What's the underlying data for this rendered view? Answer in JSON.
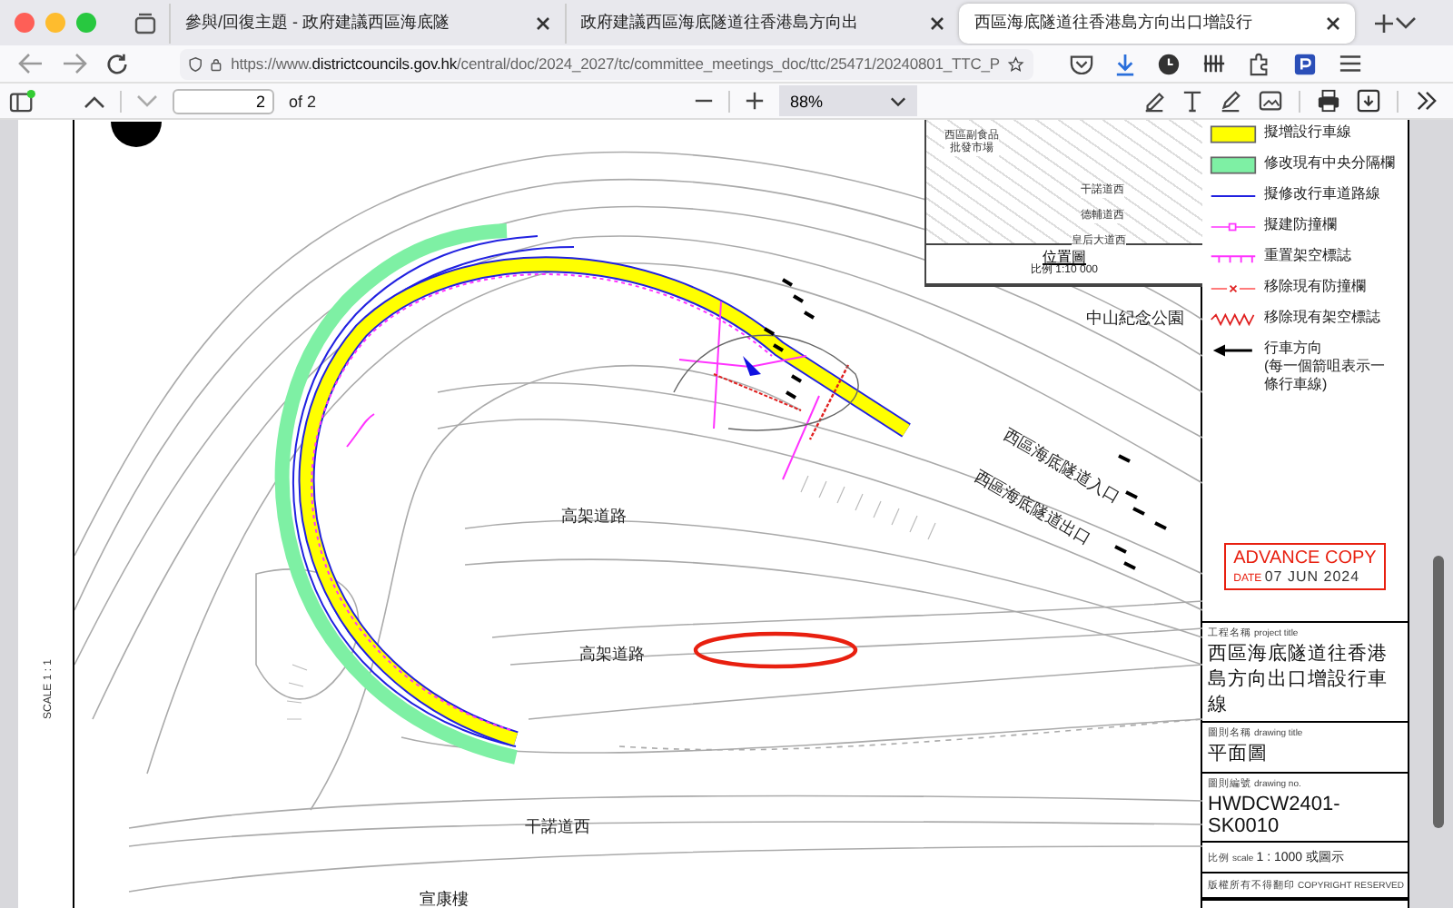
{
  "browser": {
    "tabs": [
      {
        "title": "參與/回復主題 - 政府建議西區海底隧",
        "selected": false
      },
      {
        "title": "政府建議西區海底隧道往香港島方向出",
        "selected": false
      },
      {
        "title": "西區海底隧道往香港島方向出口增設行",
        "selected": true
      }
    ],
    "url": {
      "prefix": "https://www.",
      "host": "districtcouncils.gov.hk",
      "path": "/central/doc/2024_2027/tc/committee_meetings_doc/ttc/25471/20240801_TTC_P"
    }
  },
  "pdf_toolbar": {
    "page": "2",
    "page_count": "of 2",
    "zoom": "88%"
  },
  "map_labels": {
    "park": "中山紀念公園",
    "tunnel_entrance": "西區海底隧道入口",
    "tunnel_exit": "西區海底隧道出口",
    "viaduct_upper": "高架道路",
    "viaduct_lower": "高架道路",
    "road": "干諾道西",
    "building": "宣康樓",
    "scale_bar": "SCALE 1 : 1"
  },
  "inset_map": {
    "market": [
      "西區副食品",
      "批發市場"
    ],
    "roads": [
      "干諾道西",
      "德輔道西",
      "皇后大道西"
    ],
    "title": "位置圖",
    "scale": "比例 1:10 000"
  },
  "legend": [
    {
      "kind": "new_lane",
      "label": "擬增設行車線"
    },
    {
      "kind": "median",
      "label": "修改現有中央分隔欄"
    },
    {
      "kind": "lane_line",
      "label": "擬修改行車道路線"
    },
    {
      "kind": "barrier",
      "label": "擬建防撞欄"
    },
    {
      "kind": "gantry",
      "label": "重置架空標誌"
    },
    {
      "kind": "remove_barrier",
      "label": "移除現有防撞欄"
    },
    {
      "kind": "remove_gantry",
      "label": "移除現有架空標誌"
    },
    {
      "kind": "direction",
      "label": "行車方向",
      "lines": [
        "(每一個箭咀表示一",
        "條行車線)"
      ]
    }
  ],
  "title_block": {
    "stamp": {
      "title": "ADVANCE COPY",
      "date_label": "DATE",
      "date": "07 JUN 2024"
    },
    "project": {
      "label_zh": "工程名稱",
      "label_en": "project title",
      "value": "西區海底隧道往香港島方向出口增設行車線"
    },
    "drawing_title": {
      "label_zh": "圖則名稱",
      "label_en": "drawing title",
      "value": "平面圖"
    },
    "drawing_no": {
      "label_zh": "圖則編號",
      "label_en": "drawing no.",
      "value": "HWDCW2401-SK0010"
    },
    "scale": {
      "label_zh": "比例",
      "label_en": "scale",
      "value": "1 : 1000 或圖示"
    },
    "copyright": {
      "zh": "版權所有不得翻印",
      "en": "COPYRIGHT RESERVED"
    }
  }
}
